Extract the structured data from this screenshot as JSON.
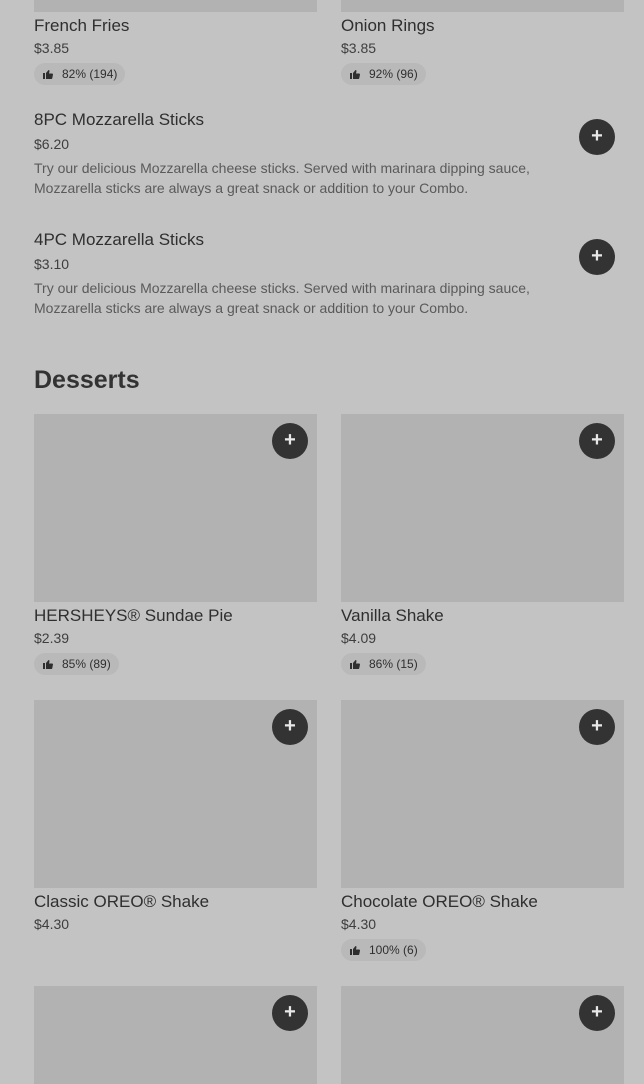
{
  "sides": {
    "grid_top": [
      {
        "name": "French Fries",
        "price": "$3.85",
        "rating": "82% (194)"
      },
      {
        "name": "Onion Rings",
        "price": "$3.85",
        "rating": "92% (96)"
      }
    ],
    "list": [
      {
        "name": "8PC Mozzarella Sticks",
        "price": "$6.20",
        "description": "Try our delicious Mozzarella cheese sticks. Served with marinara dipping sauce, Mozzarella sticks are always a great snack or addition to your Combo."
      },
      {
        "name": "4PC Mozzarella Sticks",
        "price": "$3.10",
        "description": "Try our delicious Mozzarella cheese sticks. Served with marinara dipping sauce, Mozzarella sticks are always a great snack or addition to your Combo."
      }
    ]
  },
  "desserts": {
    "title": "Desserts",
    "items": [
      {
        "name": "HERSHEYS® Sundae Pie",
        "price": "$2.39",
        "rating": "85% (89)"
      },
      {
        "name": "Vanilla Shake",
        "price": "$4.09",
        "rating": "86% (15)"
      },
      {
        "name": "Classic OREO® Shake",
        "price": "$4.30",
        "rating": ""
      },
      {
        "name": "Chocolate OREO® Shake",
        "price": "$4.30",
        "rating": "100% (6)"
      }
    ]
  },
  "ui": {
    "add_glyph": "+",
    "add_icon": "plus-icon",
    "rating_icon": "thumbs-up-icon",
    "colors": {
      "background": "#c3c3c3",
      "image_placeholder": "#b2b2b2",
      "add_button": "#333333",
      "rating_pill": "#b9b9b9"
    }
  }
}
